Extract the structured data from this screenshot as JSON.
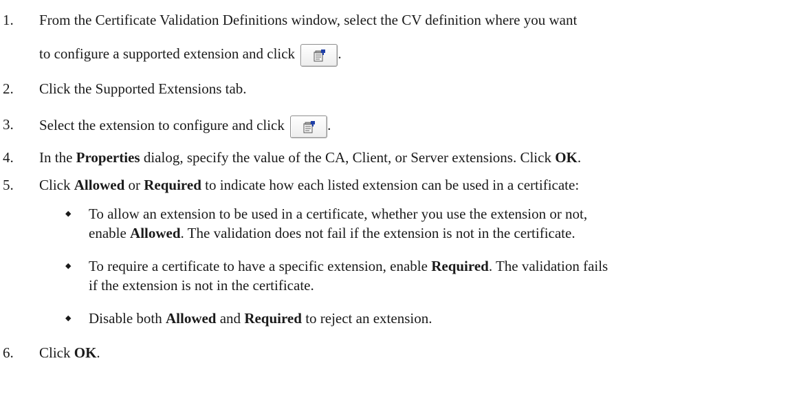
{
  "steps": [
    {
      "num": "1.",
      "text_a": "From the Certificate Validation Definitions window, select the CV definition where you want",
      "text_b": "to configure a supported extension and click",
      "text_c": "."
    },
    {
      "num": "2.",
      "text_a": "Click the Supported Extensions tab."
    },
    {
      "num": "3.",
      "text_a": "Select the extension to configure and click",
      "text_c": "."
    },
    {
      "num": "4.",
      "text_a": "In the ",
      "bold_a": "Properties",
      "text_b": " dialog, specify the value of the CA, Client, or Server extensions. Click ",
      "bold_b": "OK",
      "text_c": "."
    },
    {
      "num": "5.",
      "text_a": "Click ",
      "bold_a": "Allowed",
      "text_b": " or ",
      "bold_b": "Required",
      "text_c": " to indicate how each listed extension can be used in a certificate:"
    },
    {
      "num": "6.",
      "text_a": "Click ",
      "bold_a": "OK",
      "text_c": "."
    }
  ],
  "bullets": [
    {
      "line1_a": "To allow an extension to be used in a certificate, whether you use the extension or not,",
      "line2_a": "enable ",
      "line2_bold": "Allowed",
      "line2_b": ". The validation does not fail if the extension is not in the certificate."
    },
    {
      "line1_a": "To require a certificate to have a specific extension, enable ",
      "line1_bold": "Required",
      "line1_b": ". The validation fails",
      "line2_a": "if the extension is not in the certificate."
    },
    {
      "line1_a": "Disable both ",
      "bold_a": "Allowed",
      "line1_b": " and ",
      "bold_b": "Required",
      "line1_c": " to reject an extension."
    }
  ],
  "icons": {
    "properties_button": "properties-icon",
    "bullet": "diamond-bullet-icon"
  }
}
